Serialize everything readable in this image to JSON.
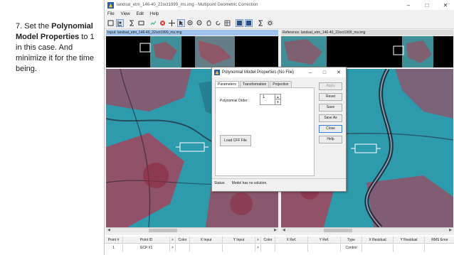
{
  "instruction": {
    "prefix": "7. Set the ",
    "emphasis": "Polynomial Model Properties",
    "suffix": " to 1 in this case. And minimize it for the time being."
  },
  "window": {
    "title": "landsat_etm_146-40_22oct1999_ms.img - Multipoint Geometric Correction",
    "controls": {
      "minimize": "–",
      "maximize": "□",
      "close": "✕"
    }
  },
  "menu": [
    "File",
    "View",
    "Edit",
    "Help"
  ],
  "toolbar": {
    "icons": [
      "new-icon",
      "gcp-icon",
      "sigma-icon",
      "sigma-edit-icon",
      "chart-icon",
      "delete-icon",
      "crosshair-icon",
      "select-icon",
      "zoom-in-icon",
      "zoom-out-icon",
      "pan-icon",
      "refresh-icon",
      "table-icon",
      "lock-icon",
      "sigma-icon-2",
      "settings-icon"
    ]
  },
  "views": {
    "input_label": "Input: landsat_etm_146-40_22oct1999_ms.img",
    "reference_label": "Reference: landsat_etm_146-40_22oct1999_ms.img"
  },
  "dialog": {
    "title": "Polynomial Model Properties (No File)",
    "controls": {
      "minimize": "–",
      "maximize": "□",
      "close": "✕"
    },
    "tabs": [
      "Parameters",
      "Transformation",
      "Projection"
    ],
    "active_tab": "Parameters",
    "polynomial_order_label": "Polynomial Order:",
    "polynomial_order_value": "1",
    "load_cff": "Load CFF File",
    "buttons": [
      "Apply",
      "Reset",
      "Save",
      "Save As",
      "Close",
      "Help"
    ],
    "status_label": "Status:",
    "status_text": "Model has no solution."
  },
  "gcp_table": {
    "headers": [
      "Point #",
      "Point ID",
      ">",
      "Color",
      "X Input",
      "Y Input",
      ">",
      "Color",
      "X Ref.",
      "Y Ref.",
      "Type",
      "X Residual",
      "Y Residual",
      "RMS Error"
    ],
    "row": [
      "1",
      "GCP #1",
      ">",
      "",
      "",
      "",
      ">",
      "",
      "",
      "",
      "Control",
      "",
      "",
      ""
    ]
  },
  "colors": {
    "vegetation_red": "#c62a45",
    "water_cyan": "#2e9bad",
    "dark": "#1a1a2a"
  }
}
